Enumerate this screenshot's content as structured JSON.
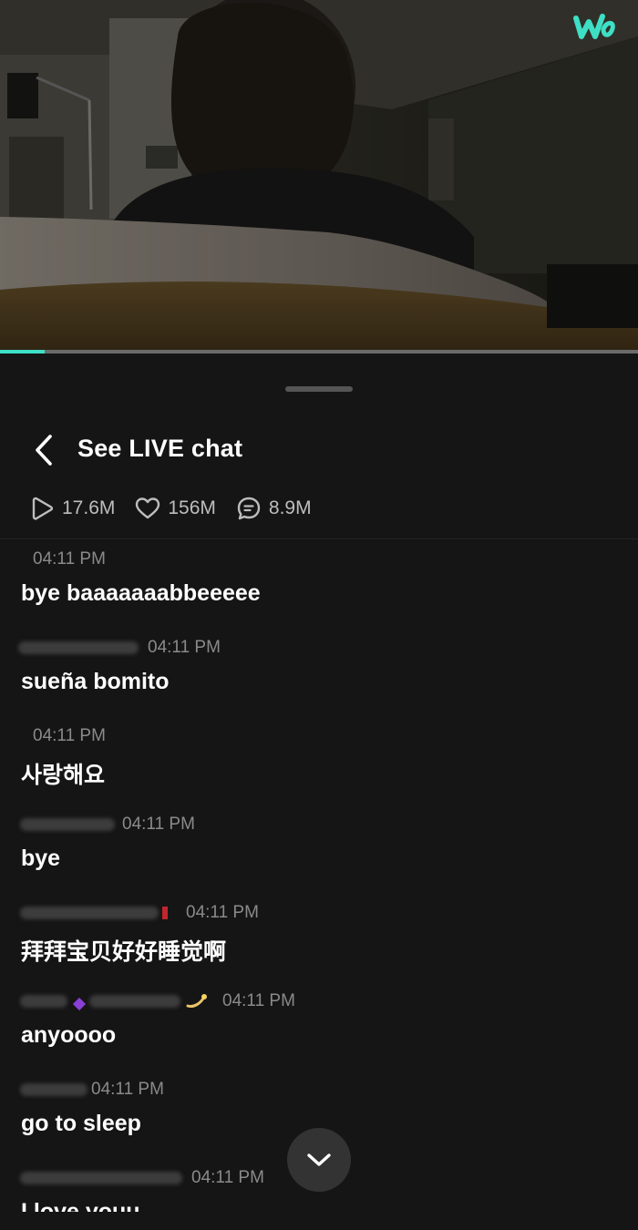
{
  "video": {
    "brand_logo": "weverse-w-logo",
    "progress": 0.07,
    "colors": {
      "accent": "#3ee0c5",
      "track": "#6b6b6b"
    }
  },
  "sheet": {
    "title": "See LIVE chat",
    "back_icon": "chevron-left-icon"
  },
  "stats": [
    {
      "icon": "play-icon",
      "value": "17.6M"
    },
    {
      "icon": "heart-icon",
      "value": "156M"
    },
    {
      "icon": "chat-bubble-icon",
      "value": "8.9M"
    }
  ],
  "chat": {
    "messages": [
      {
        "time": "04:11 PM",
        "text": "bye baaaaaaabbeeeee"
      },
      {
        "time": "04:11 PM",
        "text": "sueña bomito"
      },
      {
        "time": "04:11 PM",
        "text": "사랑해요"
      },
      {
        "time": "04:11 PM",
        "text": "bye"
      },
      {
        "time": "04:11 PM",
        "text": "拜拜宝贝好好睡觉啊"
      },
      {
        "time": "04:11 PM",
        "text": "anyoooo"
      },
      {
        "time": "04:11 PM",
        "text": "go to sleep"
      },
      {
        "time": "04:11 PM",
        "text": "I love youu"
      }
    ]
  },
  "scroll_down_icon": "chevron-down-icon"
}
